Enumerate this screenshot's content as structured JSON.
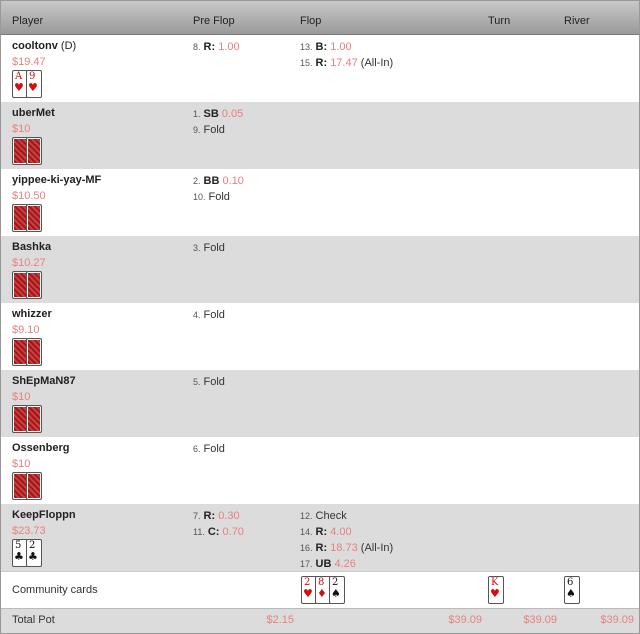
{
  "columns": {
    "player": "Player",
    "preflop": "Pre Flop",
    "flop": "Flop",
    "turn": "Turn",
    "river": "River"
  },
  "players": [
    {
      "name": "cooltonv",
      "tag": "(D)",
      "stack": "$19.47",
      "cards": [
        {
          "rank": "A",
          "suit": "♥",
          "color": "red"
        },
        {
          "rank": "9",
          "suit": "♥",
          "color": "red"
        }
      ],
      "preflop": [
        {
          "n": "8.",
          "k": "R:",
          "amt": "1.00",
          "note": ""
        }
      ],
      "flop": [
        {
          "n": "13.",
          "k": "B:",
          "amt": "1.00",
          "note": ""
        },
        {
          "n": "15.",
          "k": "R:",
          "amt": "17.47",
          "note": "(All-In)"
        }
      ]
    },
    {
      "name": "uberMet",
      "tag": "",
      "stack": "$10",
      "cards": [
        {
          "back": true
        },
        {
          "back": true
        }
      ],
      "preflop": [
        {
          "n": "1.",
          "k": "SB",
          "amt": "0.05",
          "note": ""
        },
        {
          "n": "9.",
          "k": "",
          "amt": "",
          "note": "Fold"
        }
      ],
      "flop": []
    },
    {
      "name": "yippee-ki-yay-MF",
      "tag": "",
      "stack": "$10.50",
      "cards": [
        {
          "back": true
        },
        {
          "back": true
        }
      ],
      "preflop": [
        {
          "n": "2.",
          "k": "BB",
          "amt": "0.10",
          "note": ""
        },
        {
          "n": "10.",
          "k": "",
          "amt": "",
          "note": "Fold"
        }
      ],
      "flop": []
    },
    {
      "name": "Bashka",
      "tag": "",
      "stack": "$10.27",
      "cards": [
        {
          "back": true
        },
        {
          "back": true
        }
      ],
      "preflop": [
        {
          "n": "3.",
          "k": "",
          "amt": "",
          "note": "Fold"
        }
      ],
      "flop": []
    },
    {
      "name": "whizzer",
      "tag": "",
      "stack": "$9.10",
      "cards": [
        {
          "back": true
        },
        {
          "back": true
        }
      ],
      "preflop": [
        {
          "n": "4.",
          "k": "",
          "amt": "",
          "note": "Fold"
        }
      ],
      "flop": []
    },
    {
      "name": "ShEpMaN87",
      "tag": "",
      "stack": "$10",
      "cards": [
        {
          "back": true
        },
        {
          "back": true
        }
      ],
      "preflop": [
        {
          "n": "5.",
          "k": "",
          "amt": "",
          "note": "Fold"
        }
      ],
      "flop": []
    },
    {
      "name": "Ossenberg",
      "tag": "",
      "stack": "$10",
      "cards": [
        {
          "back": true
        },
        {
          "back": true
        }
      ],
      "preflop": [
        {
          "n": "6.",
          "k": "",
          "amt": "",
          "note": "Fold"
        }
      ],
      "flop": []
    },
    {
      "name": "KeepFloppn",
      "tag": "",
      "stack": "$23.73",
      "cards": [
        {
          "rank": "5",
          "suit": "♣",
          "color": "black"
        },
        {
          "rank": "2",
          "suit": "♣",
          "color": "black"
        }
      ],
      "preflop": [
        {
          "n": "7.",
          "k": "R:",
          "amt": "0.30",
          "note": ""
        },
        {
          "n": "11.",
          "k": "C:",
          "amt": "0.70",
          "note": ""
        }
      ],
      "flop": [
        {
          "n": "12.",
          "k": "",
          "amt": "",
          "note": "Check"
        },
        {
          "n": "14.",
          "k": "R:",
          "amt": "4.00",
          "note": ""
        },
        {
          "n": "16.",
          "k": "R:",
          "amt": "18.73",
          "note": "(All-In)"
        },
        {
          "n": "17.",
          "k": "UB",
          "amt": "4.26",
          "note": ""
        }
      ]
    }
  ],
  "community": {
    "label": "Community cards",
    "flop": [
      {
        "rank": "2",
        "suit": "♥",
        "color": "red"
      },
      {
        "rank": "8",
        "suit": "♦",
        "color": "red"
      },
      {
        "rank": "2",
        "suit": "♠",
        "color": "black"
      }
    ],
    "turn": [
      {
        "rank": "K",
        "suit": "♥",
        "color": "red"
      }
    ],
    "river": [
      {
        "rank": "6",
        "suit": "♠",
        "color": "black"
      }
    ]
  },
  "total_pot": {
    "label": "Total Pot",
    "preflop": "$2.15",
    "flop": "$39.09",
    "turn": "$39.09",
    "river": "$39.09"
  }
}
